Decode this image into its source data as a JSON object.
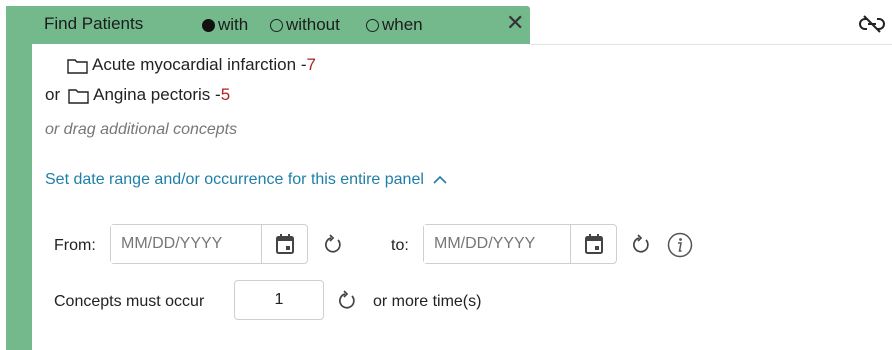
{
  "header": {
    "title": "Find Patients",
    "options": [
      {
        "label": "with",
        "selected": true
      },
      {
        "label": "without",
        "selected": false
      },
      {
        "label": "when",
        "selected": false
      }
    ],
    "close_icon": "close-icon",
    "accent_color": "#74b98c"
  },
  "concepts": [
    {
      "prefix": "",
      "name": "Acute myocardial infarction - ",
      "count": "7"
    },
    {
      "prefix": "or",
      "name": "Angina pectoris - ",
      "count": "5"
    }
  ],
  "drag_hint": "or drag additional concepts",
  "date_section": {
    "link_label": "Set date range and/or occurrence for this entire panel",
    "from_label": "From:",
    "to_label": "to:",
    "from_placeholder": "MM/DD/YYYY",
    "to_placeholder": "MM/DD/YYYY",
    "occur_label": "Concepts must occur",
    "occur_value": "1",
    "occur_suffix": "or more time(s)"
  },
  "colors": {
    "link": "#1f7fa8",
    "count": "#b22222"
  }
}
